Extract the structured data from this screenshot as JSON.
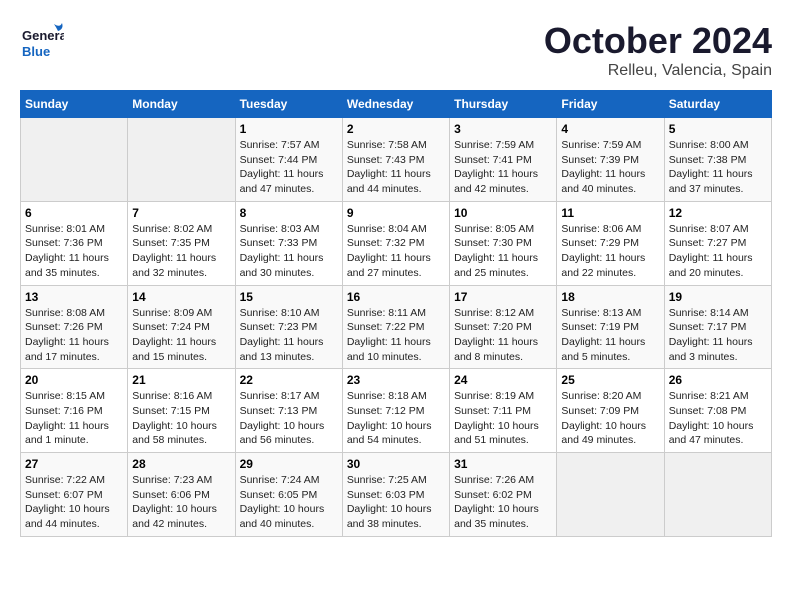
{
  "header": {
    "logo_general": "General",
    "logo_blue": "Blue",
    "month": "October 2024",
    "location": "Relleu, Valencia, Spain"
  },
  "days_of_week": [
    "Sunday",
    "Monday",
    "Tuesday",
    "Wednesday",
    "Thursday",
    "Friday",
    "Saturday"
  ],
  "weeks": [
    [
      {
        "day": "",
        "sunrise": "",
        "sunset": "",
        "daylight": ""
      },
      {
        "day": "",
        "sunrise": "",
        "sunset": "",
        "daylight": ""
      },
      {
        "day": "1",
        "sunrise": "Sunrise: 7:57 AM",
        "sunset": "Sunset: 7:44 PM",
        "daylight": "Daylight: 11 hours and 47 minutes."
      },
      {
        "day": "2",
        "sunrise": "Sunrise: 7:58 AM",
        "sunset": "Sunset: 7:43 PM",
        "daylight": "Daylight: 11 hours and 44 minutes."
      },
      {
        "day": "3",
        "sunrise": "Sunrise: 7:59 AM",
        "sunset": "Sunset: 7:41 PM",
        "daylight": "Daylight: 11 hours and 42 minutes."
      },
      {
        "day": "4",
        "sunrise": "Sunrise: 7:59 AM",
        "sunset": "Sunset: 7:39 PM",
        "daylight": "Daylight: 11 hours and 40 minutes."
      },
      {
        "day": "5",
        "sunrise": "Sunrise: 8:00 AM",
        "sunset": "Sunset: 7:38 PM",
        "daylight": "Daylight: 11 hours and 37 minutes."
      }
    ],
    [
      {
        "day": "6",
        "sunrise": "Sunrise: 8:01 AM",
        "sunset": "Sunset: 7:36 PM",
        "daylight": "Daylight: 11 hours and 35 minutes."
      },
      {
        "day": "7",
        "sunrise": "Sunrise: 8:02 AM",
        "sunset": "Sunset: 7:35 PM",
        "daylight": "Daylight: 11 hours and 32 minutes."
      },
      {
        "day": "8",
        "sunrise": "Sunrise: 8:03 AM",
        "sunset": "Sunset: 7:33 PM",
        "daylight": "Daylight: 11 hours and 30 minutes."
      },
      {
        "day": "9",
        "sunrise": "Sunrise: 8:04 AM",
        "sunset": "Sunset: 7:32 PM",
        "daylight": "Daylight: 11 hours and 27 minutes."
      },
      {
        "day": "10",
        "sunrise": "Sunrise: 8:05 AM",
        "sunset": "Sunset: 7:30 PM",
        "daylight": "Daylight: 11 hours and 25 minutes."
      },
      {
        "day": "11",
        "sunrise": "Sunrise: 8:06 AM",
        "sunset": "Sunset: 7:29 PM",
        "daylight": "Daylight: 11 hours and 22 minutes."
      },
      {
        "day": "12",
        "sunrise": "Sunrise: 8:07 AM",
        "sunset": "Sunset: 7:27 PM",
        "daylight": "Daylight: 11 hours and 20 minutes."
      }
    ],
    [
      {
        "day": "13",
        "sunrise": "Sunrise: 8:08 AM",
        "sunset": "Sunset: 7:26 PM",
        "daylight": "Daylight: 11 hours and 17 minutes."
      },
      {
        "day": "14",
        "sunrise": "Sunrise: 8:09 AM",
        "sunset": "Sunset: 7:24 PM",
        "daylight": "Daylight: 11 hours and 15 minutes."
      },
      {
        "day": "15",
        "sunrise": "Sunrise: 8:10 AM",
        "sunset": "Sunset: 7:23 PM",
        "daylight": "Daylight: 11 hours and 13 minutes."
      },
      {
        "day": "16",
        "sunrise": "Sunrise: 8:11 AM",
        "sunset": "Sunset: 7:22 PM",
        "daylight": "Daylight: 11 hours and 10 minutes."
      },
      {
        "day": "17",
        "sunrise": "Sunrise: 8:12 AM",
        "sunset": "Sunset: 7:20 PM",
        "daylight": "Daylight: 11 hours and 8 minutes."
      },
      {
        "day": "18",
        "sunrise": "Sunrise: 8:13 AM",
        "sunset": "Sunset: 7:19 PM",
        "daylight": "Daylight: 11 hours and 5 minutes."
      },
      {
        "day": "19",
        "sunrise": "Sunrise: 8:14 AM",
        "sunset": "Sunset: 7:17 PM",
        "daylight": "Daylight: 11 hours and 3 minutes."
      }
    ],
    [
      {
        "day": "20",
        "sunrise": "Sunrise: 8:15 AM",
        "sunset": "Sunset: 7:16 PM",
        "daylight": "Daylight: 11 hours and 1 minute."
      },
      {
        "day": "21",
        "sunrise": "Sunrise: 8:16 AM",
        "sunset": "Sunset: 7:15 PM",
        "daylight": "Daylight: 10 hours and 58 minutes."
      },
      {
        "day": "22",
        "sunrise": "Sunrise: 8:17 AM",
        "sunset": "Sunset: 7:13 PM",
        "daylight": "Daylight: 10 hours and 56 minutes."
      },
      {
        "day": "23",
        "sunrise": "Sunrise: 8:18 AM",
        "sunset": "Sunset: 7:12 PM",
        "daylight": "Daylight: 10 hours and 54 minutes."
      },
      {
        "day": "24",
        "sunrise": "Sunrise: 8:19 AM",
        "sunset": "Sunset: 7:11 PM",
        "daylight": "Daylight: 10 hours and 51 minutes."
      },
      {
        "day": "25",
        "sunrise": "Sunrise: 8:20 AM",
        "sunset": "Sunset: 7:09 PM",
        "daylight": "Daylight: 10 hours and 49 minutes."
      },
      {
        "day": "26",
        "sunrise": "Sunrise: 8:21 AM",
        "sunset": "Sunset: 7:08 PM",
        "daylight": "Daylight: 10 hours and 47 minutes."
      }
    ],
    [
      {
        "day": "27",
        "sunrise": "Sunrise: 7:22 AM",
        "sunset": "Sunset: 6:07 PM",
        "daylight": "Daylight: 10 hours and 44 minutes."
      },
      {
        "day": "28",
        "sunrise": "Sunrise: 7:23 AM",
        "sunset": "Sunset: 6:06 PM",
        "daylight": "Daylight: 10 hours and 42 minutes."
      },
      {
        "day": "29",
        "sunrise": "Sunrise: 7:24 AM",
        "sunset": "Sunset: 6:05 PM",
        "daylight": "Daylight: 10 hours and 40 minutes."
      },
      {
        "day": "30",
        "sunrise": "Sunrise: 7:25 AM",
        "sunset": "Sunset: 6:03 PM",
        "daylight": "Daylight: 10 hours and 38 minutes."
      },
      {
        "day": "31",
        "sunrise": "Sunrise: 7:26 AM",
        "sunset": "Sunset: 6:02 PM",
        "daylight": "Daylight: 10 hours and 35 minutes."
      },
      {
        "day": "",
        "sunrise": "",
        "sunset": "",
        "daylight": ""
      },
      {
        "day": "",
        "sunrise": "",
        "sunset": "",
        "daylight": ""
      }
    ]
  ]
}
